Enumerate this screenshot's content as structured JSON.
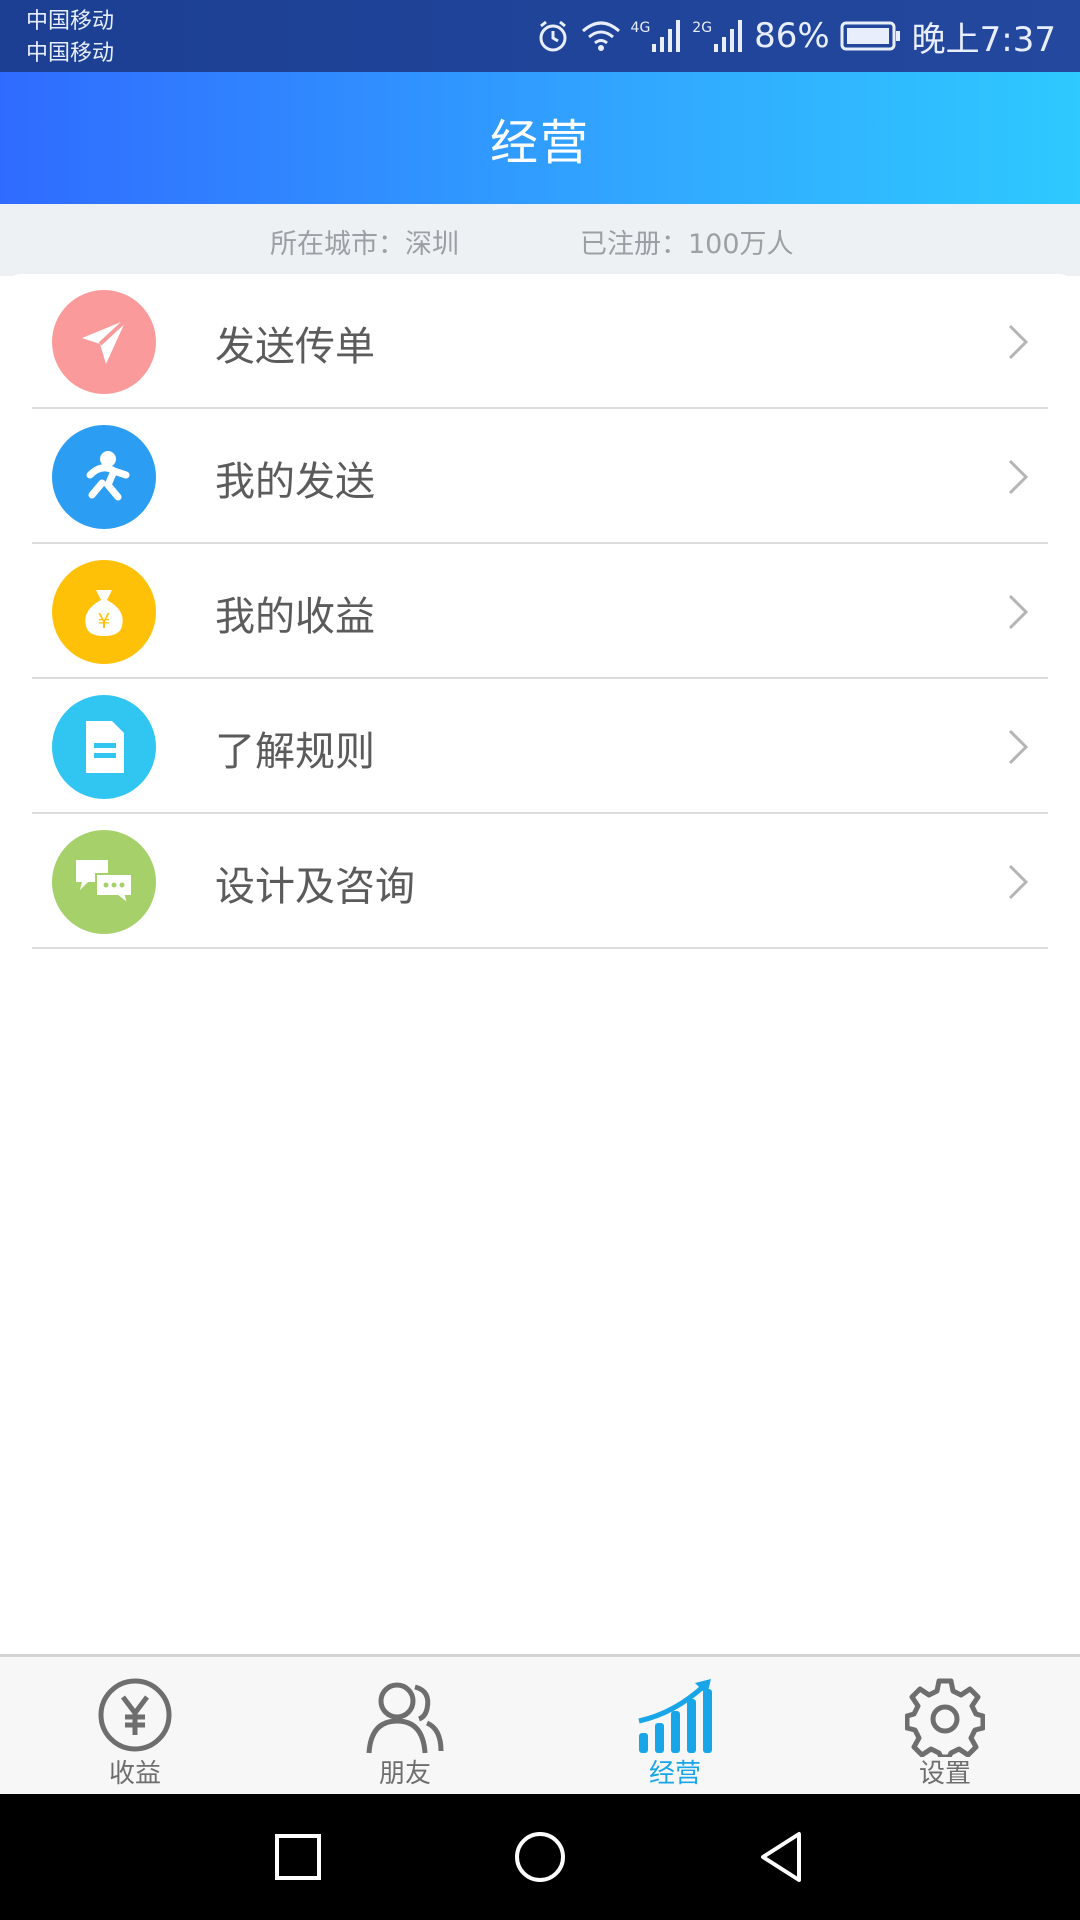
{
  "status_bar": {
    "carrier_line1": "中国移动",
    "carrier_line2": "中国移动",
    "network1": "4G",
    "network2": "2G",
    "battery_percent": "86%",
    "time": "晚上7:37"
  },
  "header": {
    "title": "经营"
  },
  "info": {
    "city": "所在城市：深圳",
    "registered": "已注册：100万人"
  },
  "menu": {
    "items": [
      {
        "label": "发送传单",
        "icon": "paper-plane-icon",
        "color": "#fb9a9a"
      },
      {
        "label": "我的发送",
        "icon": "running-person-icon",
        "color": "#2b9df2"
      },
      {
        "label": "我的收益",
        "icon": "money-bag-icon",
        "color": "#ffc107"
      },
      {
        "label": "了解规则",
        "icon": "document-icon",
        "color": "#31c6f2"
      },
      {
        "label": "设计及咨询",
        "icon": "chat-bubbles-icon",
        "color": "#a6d06a"
      }
    ]
  },
  "bottom_nav": {
    "tabs": [
      {
        "label": "收益",
        "icon": "yen-coin-icon"
      },
      {
        "label": "朋友",
        "icon": "friends-icon"
      },
      {
        "label": "经营",
        "icon": "growth-chart-icon",
        "active": true
      },
      {
        "label": "设置",
        "icon": "gear-icon"
      }
    ],
    "active_color": "#18a6e8",
    "inactive_color": "#6e6e6e"
  },
  "system_nav": {
    "buttons": [
      "square-icon",
      "circle-icon",
      "back-triangle-icon"
    ]
  }
}
